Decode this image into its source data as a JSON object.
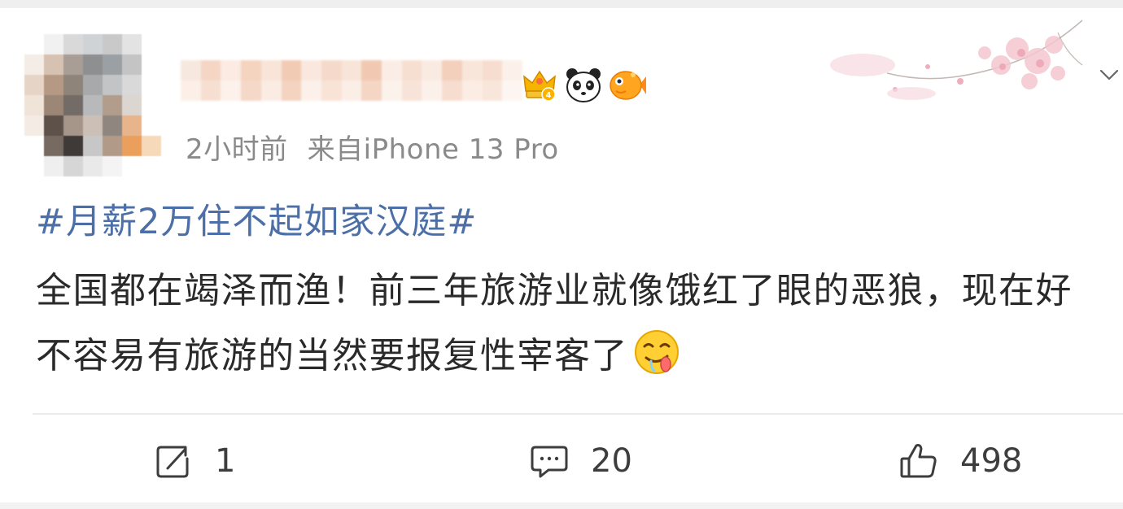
{
  "post": {
    "meta": {
      "time": "2小时前",
      "source": "来自iPhone 13 Pro"
    },
    "hashtag": "#月薪2万住不起如家汉庭#",
    "text": "全国都在竭泽而渔！前三年旅游业就像饿红了眼的恶狼，现在好不容易有旅游的当然要报复性宰客了"
  },
  "icons": {
    "badges": [
      "crown-level-icon",
      "panda-icon",
      "goldfish-icon"
    ],
    "inline_emoji": "drooling-emoji-icon",
    "more": "chevron-down-icon"
  },
  "actions": {
    "repost_count": "1",
    "comment_count": "20",
    "like_count": "498"
  },
  "colors": {
    "hashtag": "#4b6fa6",
    "text": "#2a2a2a",
    "meta": "#8a8a8a"
  }
}
